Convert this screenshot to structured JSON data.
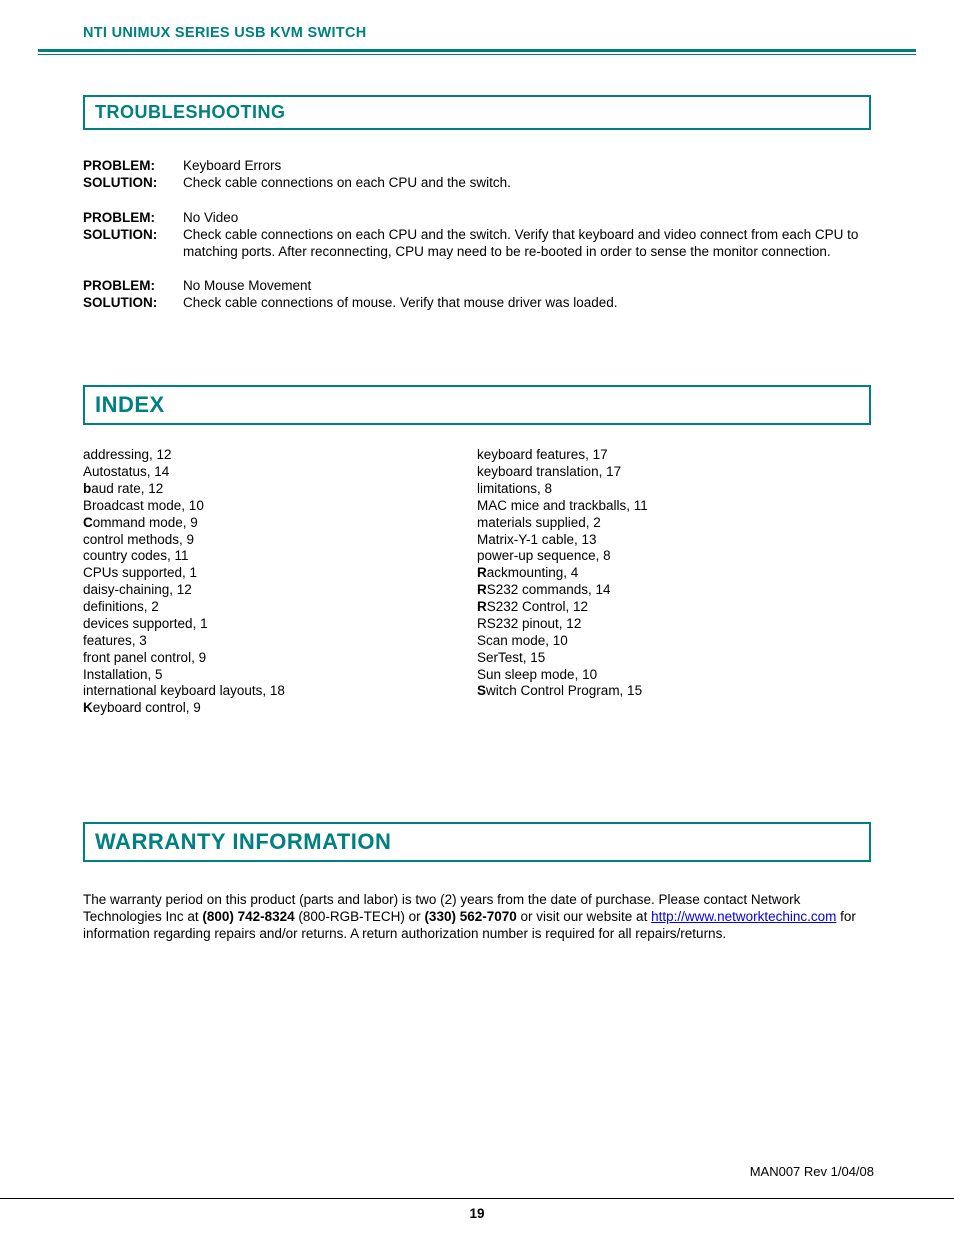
{
  "header": {
    "title": "NTI UNIMUX SERIES USB KVM SWITCH"
  },
  "sections": {
    "troubleshooting": {
      "heading": "TROUBLESHOOTING",
      "label_problem": "PROBLEM:",
      "label_solution": "SOLUTION:",
      "items": [
        {
          "problem": "Keyboard Errors",
          "solution": "Check cable connections on each CPU and the switch."
        },
        {
          "problem": "No Video",
          "solution": "Check cable connections on each CPU and the switch.  Verify that keyboard and video connect from each CPU to matching ports.  After reconnecting, CPU may need to be re-booted in order to sense the monitor connection."
        },
        {
          "problem": "No Mouse Movement",
          "solution": "Check cable connections of mouse.  Verify that mouse driver was loaded."
        }
      ]
    },
    "index": {
      "heading": "INDEX",
      "col1": [
        {
          "pre": "",
          "bold": "",
          "text": "addressing, 12"
        },
        {
          "pre": "",
          "bold": "",
          "text": "Autostatus, 14"
        },
        {
          "pre": "",
          "bold": "b",
          "text": "aud rate, 12"
        },
        {
          "pre": "",
          "bold": "",
          "text": "Broadcast mode, 10"
        },
        {
          "pre": "",
          "bold": "C",
          "text": "ommand mode, 9"
        },
        {
          "pre": "",
          "bold": "",
          "text": "control methods, 9"
        },
        {
          "pre": "",
          "bold": "",
          "text": "country codes, 11"
        },
        {
          "pre": "",
          "bold": "",
          "text": "CPUs supported, 1"
        },
        {
          "pre": "",
          "bold": "",
          "text": "daisy-chaining, 12"
        },
        {
          "pre": "",
          "bold": "",
          "text": "definitions, 2"
        },
        {
          "pre": "",
          "bold": "",
          "text": "devices supported, 1"
        },
        {
          "pre": "",
          "bold": "",
          "text": "features, 3"
        },
        {
          "pre": "",
          "bold": "",
          "text": "front panel control, 9"
        },
        {
          "pre": "",
          "bold": "",
          "text": "Installation, 5"
        },
        {
          "pre": "",
          "bold": "",
          "text": "international keyboard layouts, 18"
        },
        {
          "pre": "",
          "bold": "K",
          "text": "eyboard control, 9"
        }
      ],
      "col2": [
        {
          "pre": "",
          "bold": "",
          "text": "keyboard features, 17"
        },
        {
          "pre": "",
          "bold": "",
          "text": "keyboard translation, 17"
        },
        {
          "pre": "",
          "bold": "",
          "text": "limitations, 8"
        },
        {
          "pre": "",
          "bold": "",
          "text": "MAC mice and trackballs, 11"
        },
        {
          "pre": "",
          "bold": "",
          "text": "materials supplied, 2"
        },
        {
          "pre": "",
          "bold": "",
          "text": "Matrix-Y-1 cable, 13"
        },
        {
          "pre": "",
          "bold": "",
          "text": "power-up sequence, 8"
        },
        {
          "pre": "",
          "bold": "R",
          "text": "ackmounting, 4"
        },
        {
          "pre": "",
          "bold": "R",
          "text": "S232 commands, 14"
        },
        {
          "pre": "",
          "bold": "R",
          "text": "S232 Control, 12"
        },
        {
          "pre": "",
          "bold": "",
          "text": "RS232 pinout, 12"
        },
        {
          "pre": "",
          "bold": "",
          "text": "Scan mode, 10"
        },
        {
          "pre": "",
          "bold": "",
          "text": "SerTest, 15"
        },
        {
          "pre": "",
          "bold": "",
          "text": "Sun sleep mode, 10"
        },
        {
          "pre": "",
          "bold": "S",
          "text": "witch Control Program, 15"
        }
      ]
    },
    "warranty": {
      "heading": "WARRANTY INFORMATION",
      "text_pre": "The warranty period on this product (parts and labor) is two (2) years from the date of purchase.  Please contact Network Technologies Inc at ",
      "phone1": "(800) 742-8324",
      "text_mid1": "  (800-RGB-TECH) or ",
      "phone2": "(330) 562-7070",
      "text_mid2": " or visit our website at ",
      "url": "http://www.networktechinc.com",
      "text_post": " for information regarding repairs and/or returns.  A return authorization number is required for all repairs/returns."
    }
  },
  "footer": {
    "rev": "MAN007    Rev 1/04/08",
    "page": "19"
  }
}
